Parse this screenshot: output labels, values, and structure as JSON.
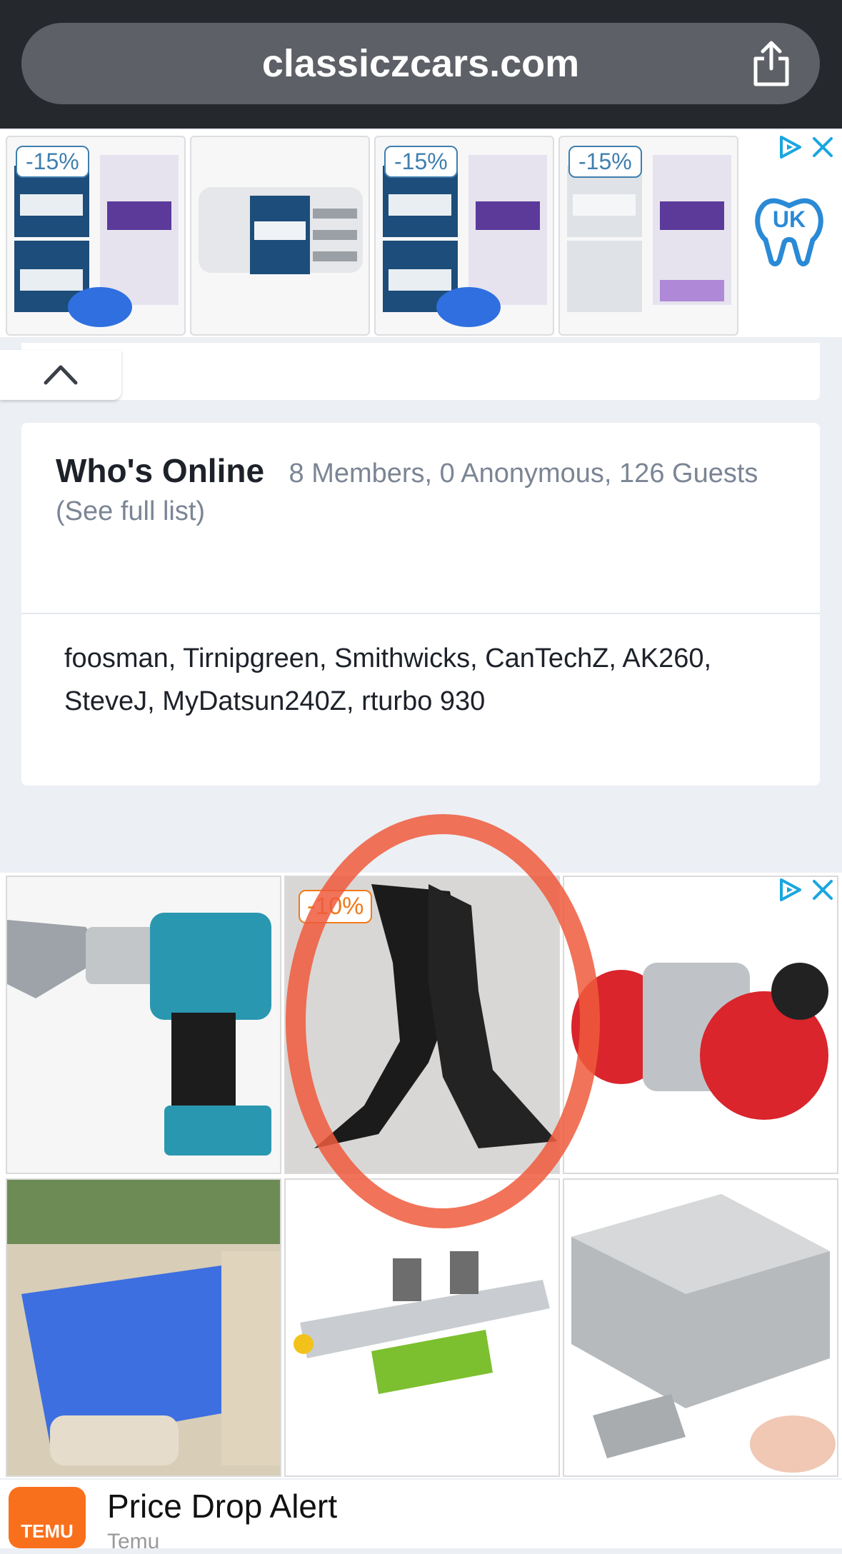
{
  "browser": {
    "url": "classiczcars.com",
    "share_icon": "share-icon"
  },
  "ad_banner_top": {
    "products": [
      {
        "badge": "-15%"
      },
      {
        "badge": ""
      },
      {
        "badge": "-15%"
      },
      {
        "badge": "-15%"
      }
    ],
    "ad_choices_icon": "ad-choices-icon",
    "close_icon": "close-icon"
  },
  "panel": {
    "collapse_icon": "chevron-up-icon"
  },
  "whos_online": {
    "title": "Who's Online",
    "stats": "8 Members, 0 Anonymous, 126 Guests",
    "see_full": "(See full list)",
    "members": "foosman, Tirnipgreen, Smithwicks, CanTechZ, AK260, SteveJ, MyDatsun240Z, rturbo 930"
  },
  "ad_banner_grid": {
    "badge": "-10%",
    "tiles": [
      "drill-shear-attachment",
      "thigh-high-boots",
      "mini-engine",
      "car-air-mattress",
      "cross-slide-vise",
      "magnet-blocks"
    ]
  },
  "bottom_ad": {
    "logo_text": "TEMU",
    "title": "Price Drop Alert",
    "subtitle": "Temu"
  },
  "colors": {
    "topbar": "#25282d",
    "urlbar": "#5d6066",
    "page_bg": "#eceff4",
    "annotation_circle": "#ef5a3c",
    "temu_orange": "#f9701c"
  }
}
